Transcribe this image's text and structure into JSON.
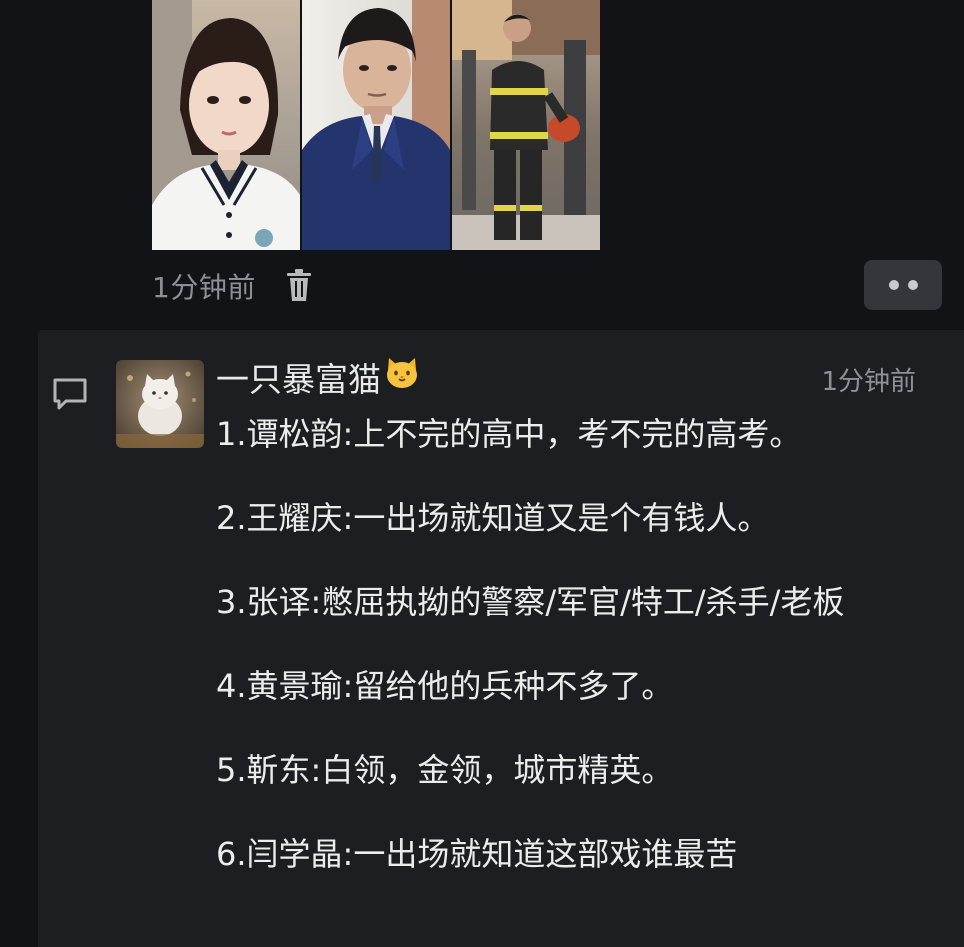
{
  "post": {
    "photos": [
      {
        "name": "student-girl-photo",
        "description_hidden": ""
      },
      {
        "name": "suited-man-photo",
        "description_hidden": ""
      },
      {
        "name": "firefighter-photo",
        "description_hidden": ""
      }
    ],
    "time_label": "1分钟前",
    "icons": {
      "delete": "trash-icon",
      "more": "more-dots-icon"
    }
  },
  "comment": {
    "username": "一只暴富猫",
    "time_label": "1分钟前",
    "icons": {
      "comment": "comment-bubble-icon",
      "avatar": "cat-avatar",
      "emoji": "cat-face-emoji"
    },
    "lines": [
      "1.谭松韵:上不完的高中，考不完的高考。",
      "2.王耀庆:一出场就知道又是个有钱人。",
      "3.张译:憋屈执拗的警察/军官/特工/杀手/老板",
      "4.黄景瑜:留给他的兵种不多了。",
      "5.靳东:白领，金领，城市精英。",
      "6.闫学晶:一出场就知道这部戏谁最苦"
    ]
  },
  "colors": {
    "background": "#121316",
    "panel": "#1d1e22",
    "text": "#ececed",
    "muted": "#8d8f94",
    "button": "#34363b"
  }
}
